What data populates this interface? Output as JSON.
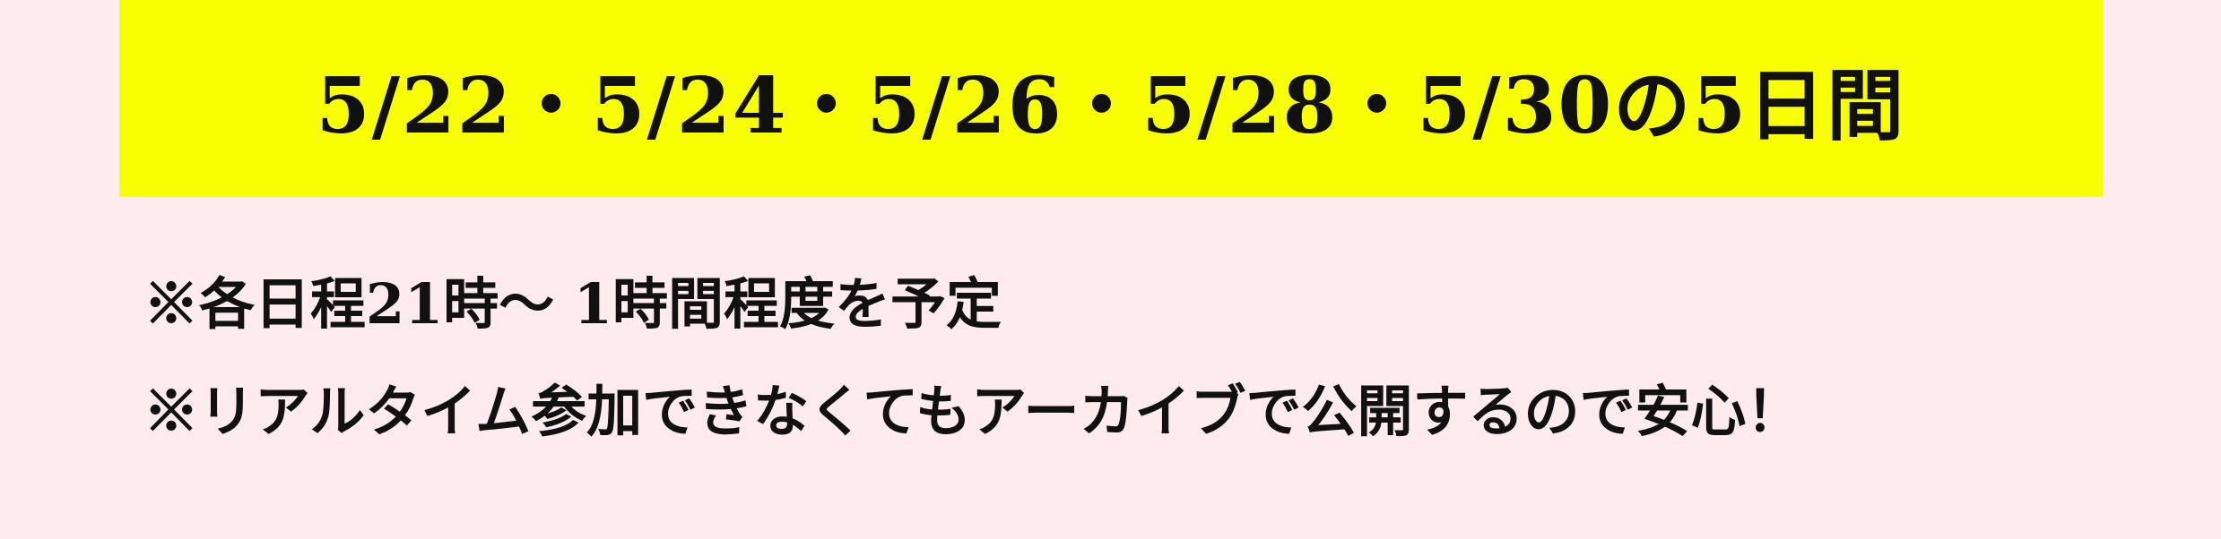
{
  "banner": {
    "text": "5/22・5/24・5/26・5/28・5/30の5日間",
    "background_color": "#f8ff00"
  },
  "notes": [
    "※各日程21時～ 1時間程度を予定",
    "※リアルタイム参加できなくてもアーカイブで公開するので安心！"
  ],
  "page": {
    "background_color": "#fdebee",
    "text_color": "#111111"
  }
}
